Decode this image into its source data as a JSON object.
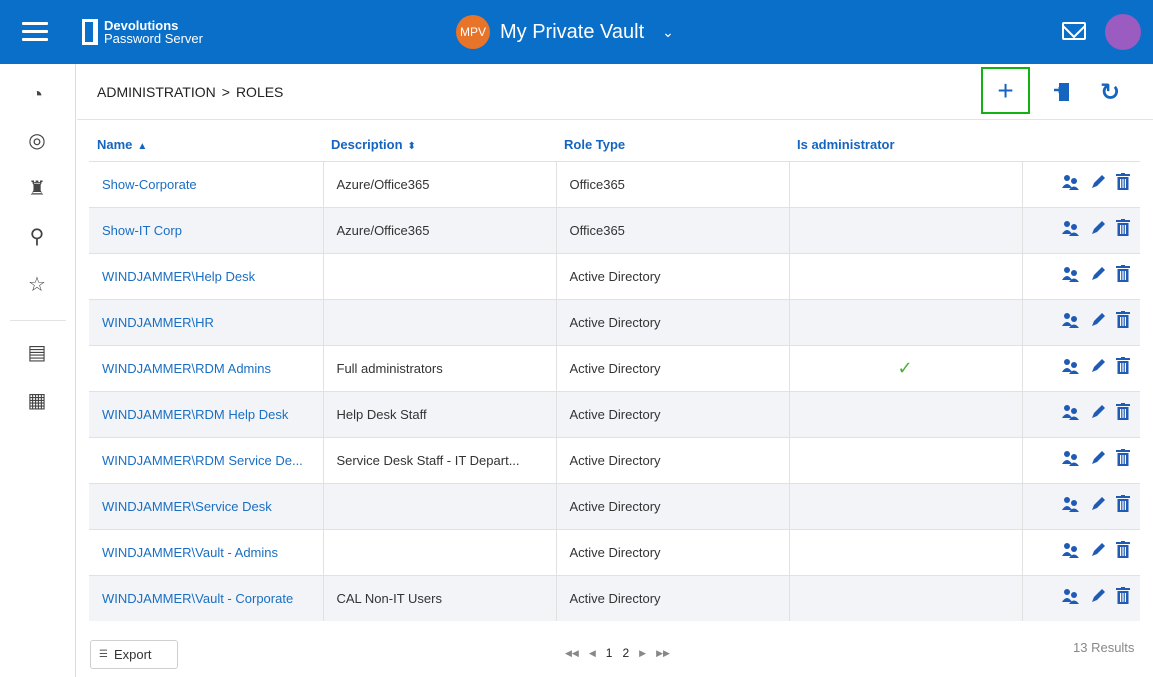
{
  "app": {
    "logo_line1": "Devolutions",
    "logo_line2": "Password Server",
    "vault_badge": "MPV",
    "vault_name": "My Private Vault",
    "vault_caret": "⌄"
  },
  "breadcrumb": {
    "section": "ADMINISTRATION",
    "separator": ">",
    "page": "ROLES"
  },
  "table": {
    "headers": {
      "name": "Name",
      "name_sort": "▲",
      "description": "Description",
      "description_sort": "⬍",
      "role_type": "Role Type",
      "is_admin": "Is administrator"
    },
    "rows": [
      {
        "name": "Show-Corporate",
        "description": "Azure/Office365",
        "role_type": "Office365",
        "is_admin": ""
      },
      {
        "name": "Show-IT Corp",
        "description": "Azure/Office365",
        "role_type": "Office365",
        "is_admin": ""
      },
      {
        "name": "WINDJAMMER\\Help Desk",
        "description": "",
        "role_type": "Active Directory",
        "is_admin": ""
      },
      {
        "name": "WINDJAMMER\\HR",
        "description": "",
        "role_type": "Active Directory",
        "is_admin": ""
      },
      {
        "name": "WINDJAMMER\\RDM Admins",
        "description": "Full administrators",
        "role_type": "Active Directory",
        "is_admin": "✓"
      },
      {
        "name": "WINDJAMMER\\RDM Help Desk",
        "description": "Help Desk Staff",
        "role_type": "Active Directory",
        "is_admin": ""
      },
      {
        "name": "WINDJAMMER\\RDM Service De...",
        "description": "Service Desk Staff - IT Depart...",
        "role_type": "Active Directory",
        "is_admin": ""
      },
      {
        "name": "WINDJAMMER\\Service Desk",
        "description": "",
        "role_type": "Active Directory",
        "is_admin": ""
      },
      {
        "name": "WINDJAMMER\\Vault - Admins",
        "description": "",
        "role_type": "Active Directory",
        "is_admin": ""
      },
      {
        "name": "WINDJAMMER\\Vault - Corporate",
        "description": "CAL Non-IT Users",
        "role_type": "Active Directory",
        "is_admin": ""
      }
    ]
  },
  "footer": {
    "export_label": "Export",
    "export_icon": "☰",
    "pager_first": "◀◀",
    "pager_prev": "◀",
    "pages": [
      "1",
      "2"
    ],
    "pager_next": "▶",
    "pager_last": "▶▶",
    "results": "13 Results"
  },
  "icons": {
    "add": "+",
    "refresh": "↻",
    "users": "👥",
    "edit": "✎",
    "delete": "🗑"
  },
  "colors": {
    "topbar": "#0a6fc9",
    "link": "#1a6fc4",
    "highlight_border": "#12b212",
    "vault_badge": "#e8742a",
    "avatar": "#9b5cc1",
    "check": "#4cae37"
  }
}
